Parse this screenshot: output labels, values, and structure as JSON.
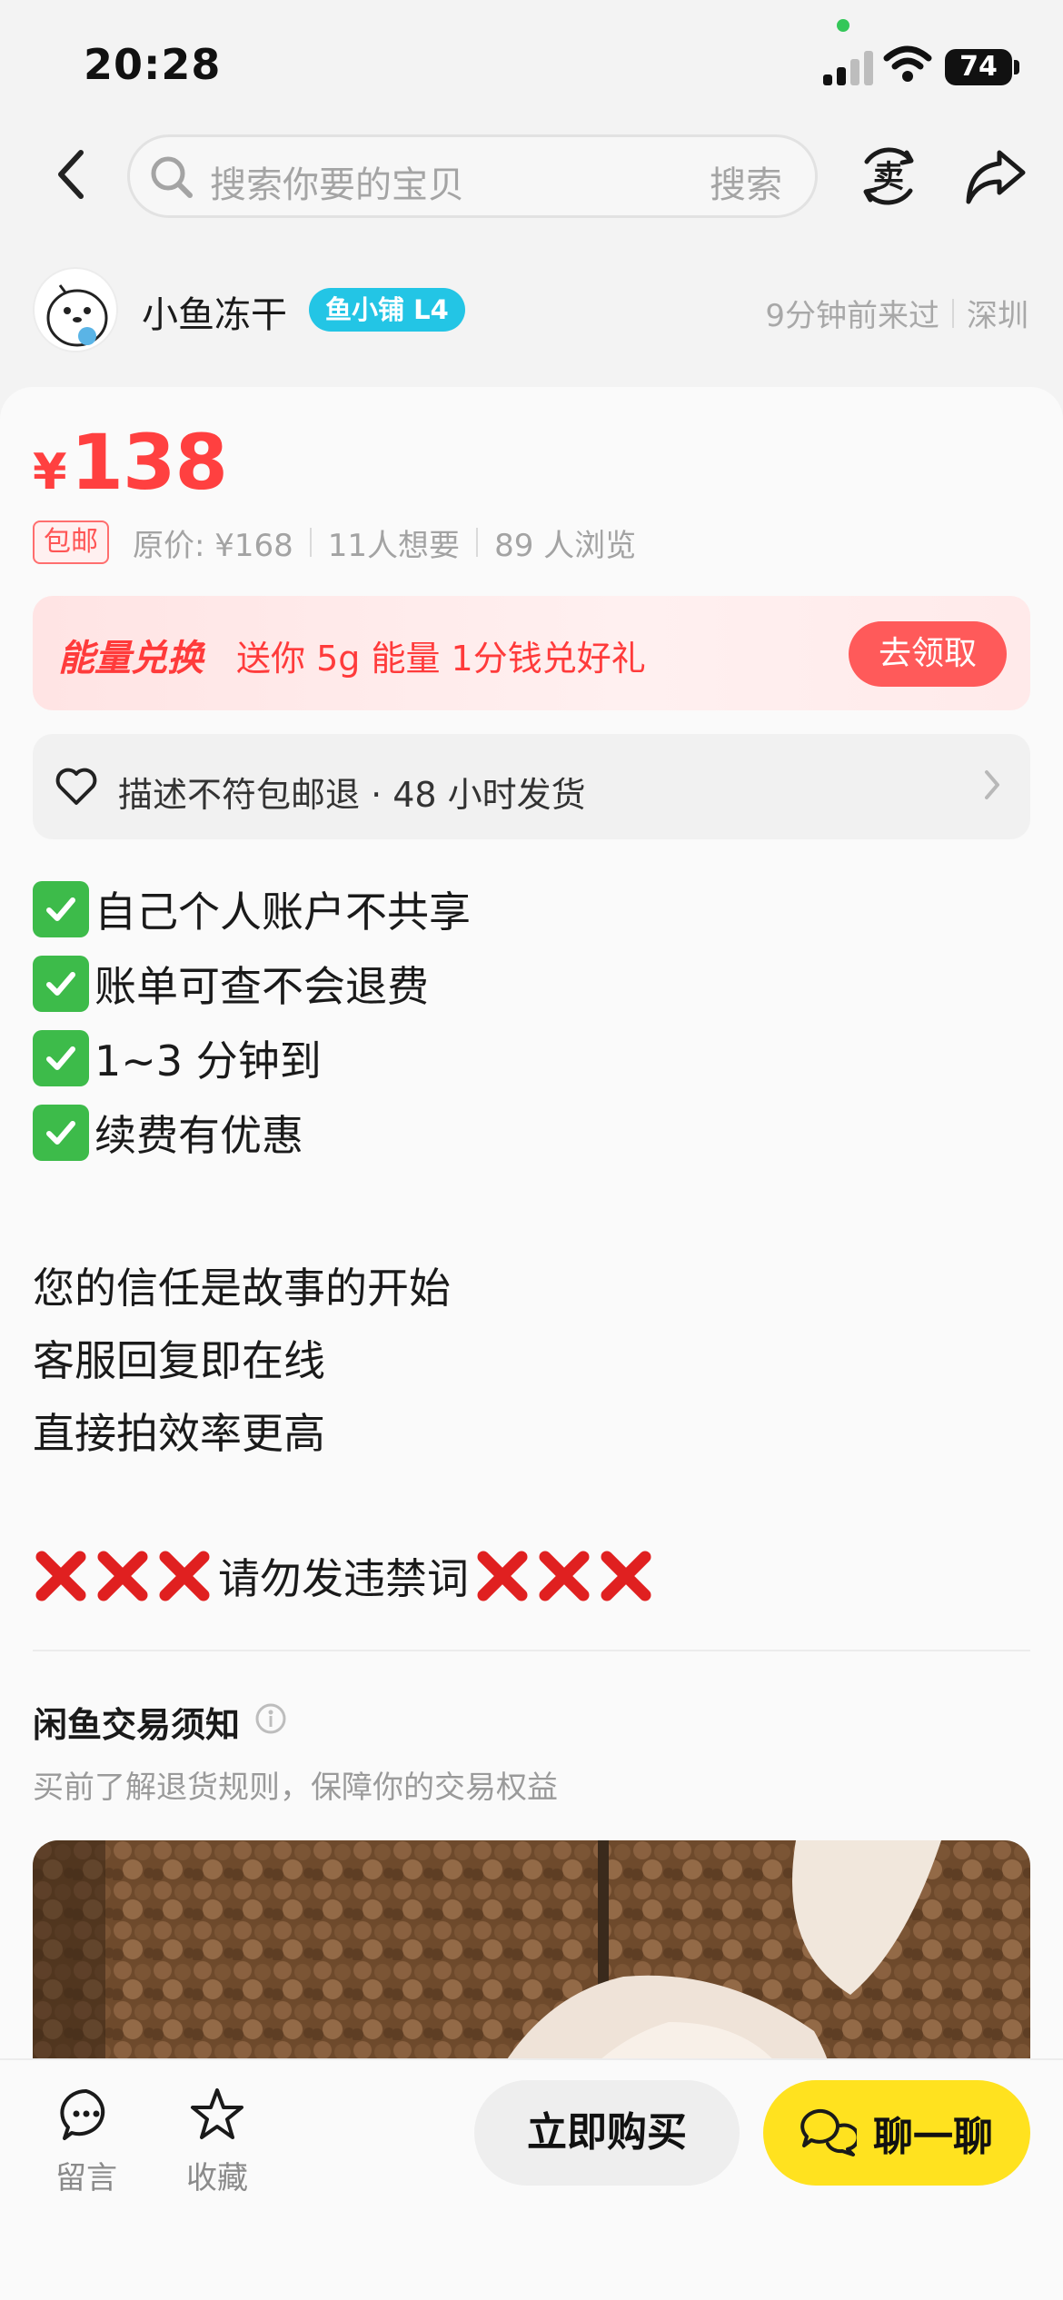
{
  "status_bar": {
    "time": "20:28",
    "battery": "74",
    "icons": [
      "signal-icon",
      "wifi-icon",
      "battery-icon"
    ]
  },
  "nav": {
    "search_placeholder": "搜索你要的宝贝",
    "search_button": "搜索",
    "sell_icon_label": "卖",
    "icons": [
      "back-icon",
      "search-icon",
      "sell-icon",
      "share-icon"
    ]
  },
  "seller": {
    "name": "小鱼冻干",
    "badge": "鱼小铺 L4",
    "last_seen": "9分钟前来过",
    "location": "深圳"
  },
  "product": {
    "currency": "¥",
    "price": "138",
    "free_shipping": "包邮",
    "original_price": "原价: ¥168",
    "wants": "11人想要",
    "views": "89 人浏览"
  },
  "energy": {
    "title": "能量兑换",
    "desc": "送你 5g 能量 1分钱兑好礼",
    "button": "去领取"
  },
  "guarantee": {
    "text": "描述不符包邮退 · 48 小时发货"
  },
  "description": {
    "checks": [
      "自己个人账户不共享",
      "账单可查不会退费",
      "1~3 分钟到",
      "续费有优惠"
    ],
    "lines": [
      "您的信任是故事的开始",
      "客服回复即在线",
      "直接拍效率更高"
    ],
    "warning": "请勿发违禁词"
  },
  "notice": {
    "title": "闲鱼交易须知",
    "subtitle": "买前了解退货规则，保障你的交易权益"
  },
  "bottom": {
    "comment": "留言",
    "favorite": "收藏",
    "buy": "立即购买",
    "chat": "聊一聊"
  },
  "colors": {
    "price_red": "#ff4040",
    "badge_cyan": "#23c5e5",
    "chat_yellow": "#ffe21f",
    "check_green": "#3dbb4a",
    "cross_red": "#e02020"
  }
}
